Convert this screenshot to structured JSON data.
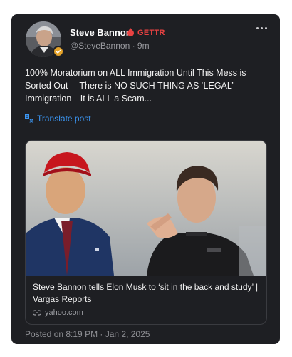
{
  "post": {
    "author_name": "Steve Bannon",
    "platform_label": "GETTR",
    "handle": "@SteveBannon",
    "separator": " · ",
    "time_ago": "9m",
    "text": "100% Moratorium on ALL Immigration Until This Mess is Sorted Out —There is NO SUCH THING AS ‘LEGAL’ Immigration—It is ALL a Scam...",
    "translate_label": "Translate post",
    "posted_on": "Posted on 8:19 PM · Jan 2, 2025"
  },
  "link_card": {
    "title": "Steve Bannon tells Elon Musk to ‘sit in the back and study’ | Vargas Reports",
    "domain": "yahoo.com"
  },
  "colors": {
    "card_bg": "#1e1f23",
    "accent_link": "#3b97f5",
    "gettr_red": "#e84242",
    "verified_badge": "#e5a32a"
  },
  "icons": [
    "more-options-icon",
    "gettr-logo-icon",
    "translate-icon",
    "link-icon",
    "verified-badge-icon"
  ]
}
